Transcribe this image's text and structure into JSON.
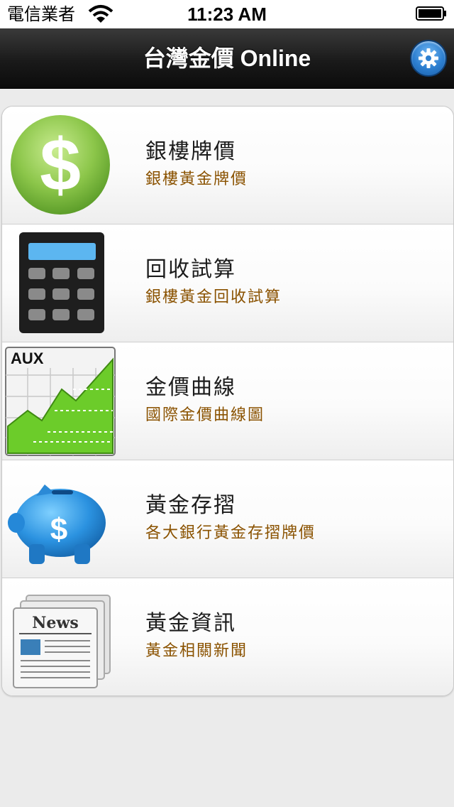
{
  "status_bar": {
    "carrier": "電信業者",
    "time": "11:23 AM"
  },
  "nav_bar": {
    "title": "台灣金價 Online"
  },
  "menu": {
    "items": [
      {
        "title": "銀樓牌價",
        "subtitle": "銀樓黃金牌價",
        "icon": "dollar-coin-icon"
      },
      {
        "title": "回收試算",
        "subtitle": "銀樓黃金回收試算",
        "icon": "calculator-icon"
      },
      {
        "title": "金價曲線",
        "subtitle": "國際金價曲線圖",
        "icon": "chart-icon",
        "icon_label": "AUX"
      },
      {
        "title": "黃金存摺",
        "subtitle": "各大銀行黃金存摺牌價",
        "icon": "piggy-bank-icon"
      },
      {
        "title": "黃金資訊",
        "subtitle": "黃金相關新聞",
        "icon": "newspaper-icon",
        "icon_label": "News"
      }
    ]
  },
  "colors": {
    "subtitle": "#8a5200",
    "nav_background": "#1a1a1a",
    "settings_button": "#2d7fd0"
  }
}
